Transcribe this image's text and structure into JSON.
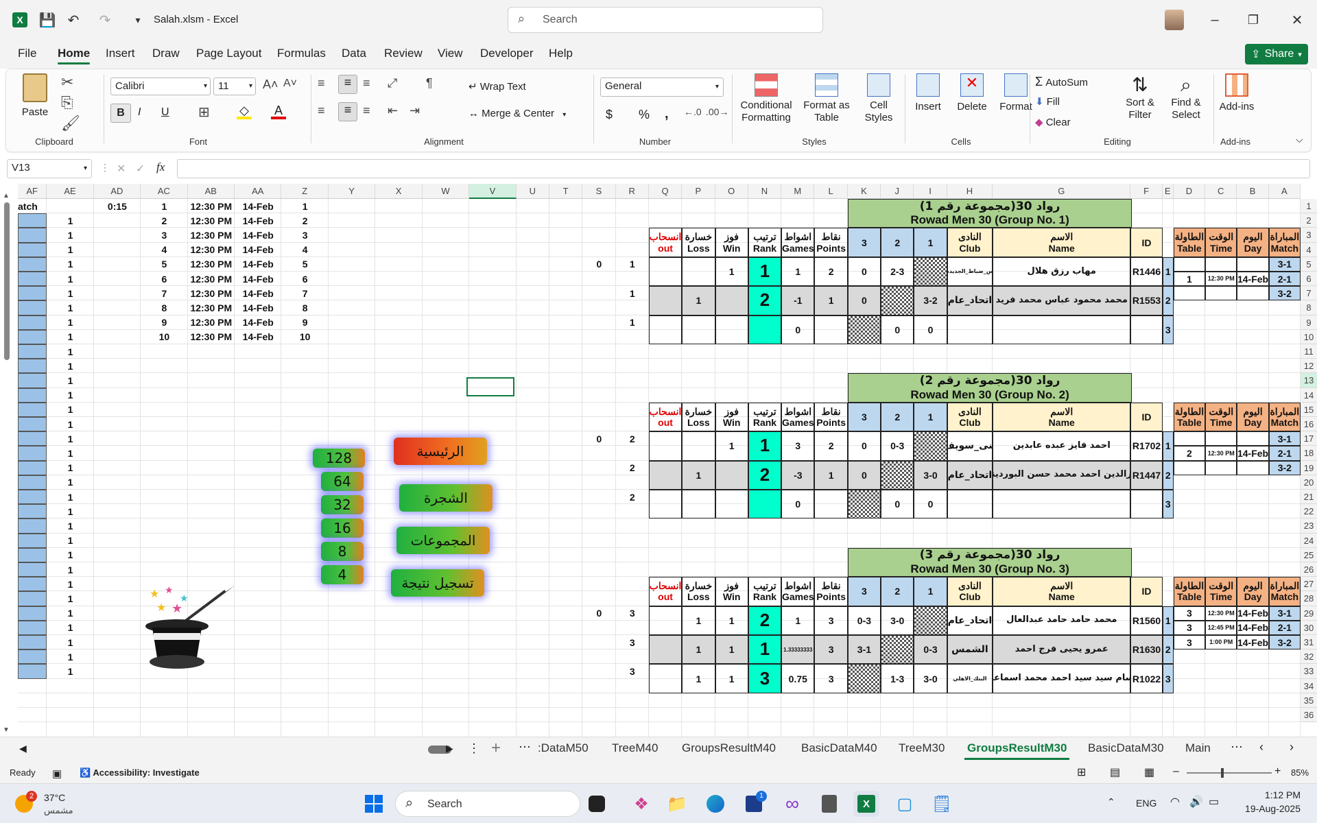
{
  "titlebar": {
    "filename": "Salah.xlsm",
    "separator": "-",
    "app": "Excel",
    "search_placeholder": "Search",
    "icons": [
      "excel-logo-icon",
      "save-icon",
      "undo-icon",
      "redo-icon",
      "customize-icon",
      "search-icon",
      "minimize-icon",
      "restore-icon",
      "close-icon"
    ]
  },
  "menu": [
    "File",
    "Home",
    "Insert",
    "Draw",
    "Page Layout",
    "Formulas",
    "Data",
    "Review",
    "View",
    "Developer",
    "Help"
  ],
  "share_label": "Share",
  "ribbon": {
    "clipboard": {
      "paste": "Paste",
      "group": "Clipboard"
    },
    "font": {
      "name": "Calibri",
      "size": "11",
      "bold": "B",
      "italic": "I",
      "underline": "U",
      "group": "Font"
    },
    "alignment": {
      "wrap": "Wrap Text",
      "merge": "Merge & Center",
      "group": "Alignment"
    },
    "number": {
      "format": "General",
      "currency": "$",
      "percent": "%",
      "comma": ",",
      "group": "Number"
    },
    "styles": {
      "conditional": "Conditional",
      "conditional2": "Formatting",
      "format_as": "Format as",
      "format_as2": "Table",
      "cell": "Cell",
      "cell2": "Styles",
      "group": "Styles"
    },
    "cells": {
      "insert": "Insert",
      "delete": "Delete",
      "format": "Format",
      "group": "Cells"
    },
    "editing": {
      "autosum": "AutoSum",
      "fill": "Fill",
      "clear": "Clear",
      "sort": "Sort &",
      "sort2": "Filter",
      "find": "Find &",
      "find2": "Select",
      "group": "Editing"
    },
    "addins": {
      "label": "Add-ins",
      "group": "Add-ins"
    }
  },
  "formula": {
    "name_box": "V13",
    "fx": "fx",
    "content": ""
  },
  "columns": [
    {
      "l": "AF",
      "w": 42
    },
    {
      "l": "AE",
      "w": 68
    },
    {
      "l": "AD",
      "w": 68
    },
    {
      "l": "AC",
      "w": 68
    },
    {
      "l": "AB",
      "w": 68
    },
    {
      "l": "AA",
      "w": 68
    },
    {
      "l": "Z",
      "w": 68
    },
    {
      "l": "Y",
      "w": 68
    },
    {
      "l": "X",
      "w": 68
    },
    {
      "l": "W",
      "w": 68
    },
    {
      "l": "V",
      "w": 68
    },
    {
      "l": "U",
      "w": 48
    },
    {
      "l": "T",
      "w": 48
    },
    {
      "l": "S",
      "w": 48
    },
    {
      "l": "R",
      "w": 48
    },
    {
      "l": "Q",
      "w": 48
    },
    {
      "l": "P",
      "w": 48
    },
    {
      "l": "O",
      "w": 48
    },
    {
      "l": "N",
      "w": 48
    },
    {
      "l": "M",
      "w": 48
    },
    {
      "l": "L",
      "w": 48
    },
    {
      "l": "K",
      "w": 48
    },
    {
      "l": "J",
      "w": 48
    },
    {
      "l": "I",
      "w": 48
    },
    {
      "l": "H",
      "w": 66
    },
    {
      "l": "G",
      "w": 200
    },
    {
      "l": "F",
      "w": 46
    },
    {
      "l": "E",
      "w": 16
    },
    {
      "l": "D",
      "w": 46
    },
    {
      "l": "C",
      "w": 46
    },
    {
      "l": "B",
      "w": 46
    },
    {
      "l": "A",
      "w": 46
    }
  ],
  "rows": [
    "1",
    "2",
    "3",
    "4",
    "5",
    "6",
    "7",
    "8",
    "9",
    "10",
    "11",
    "12",
    "13",
    "14",
    "15",
    "16",
    "17",
    "18",
    "19",
    "20",
    "21",
    "22",
    "23",
    "24",
    "25",
    "26",
    "27",
    "28",
    "29",
    "30",
    "31",
    "32",
    "33",
    "34",
    "35",
    "36"
  ],
  "left_data": {
    "header": {
      "af": "atch",
      "ad": "0:15",
      "ac": "1",
      "ab": "12:30 PM",
      "aa": "14-Feb",
      "z": "1"
    },
    "rows": [
      {
        "ae": "1",
        "ac": "2",
        "ab": "12:30 PM",
        "aa": "14-Feb",
        "z": "2"
      },
      {
        "ae": "1",
        "ac": "3",
        "ab": "12:30 PM",
        "aa": "14-Feb",
        "z": "3"
      },
      {
        "ae": "1",
        "ac": "4",
        "ab": "12:30 PM",
        "aa": "14-Feb",
        "z": "4"
      },
      {
        "ae": "1",
        "ac": "5",
        "ab": "12:30 PM",
        "aa": "14-Feb",
        "z": "5"
      },
      {
        "ae": "1",
        "ac": "6",
        "ab": "12:30 PM",
        "aa": "14-Feb",
        "z": "6"
      },
      {
        "ae": "1",
        "ac": "7",
        "ab": "12:30 PM",
        "aa": "14-Feb",
        "z": "7"
      },
      {
        "ae": "1",
        "ac": "8",
        "ab": "12:30 PM",
        "aa": "14-Feb",
        "z": "8"
      },
      {
        "ae": "1",
        "ac": "9",
        "ab": "12:30 PM",
        "aa": "14-Feb",
        "z": "9"
      },
      {
        "ae": "1",
        "ac": "10",
        "ab": "12:30 PM",
        "aa": "14-Feb",
        "z": "10"
      }
    ],
    "ae_extra": "1"
  },
  "sr_values": [
    {
      "row": 5,
      "s": "0",
      "r": "1"
    },
    {
      "row": 7,
      "s": "",
      "r": "1"
    },
    {
      "row": 9,
      "s": "",
      "r": "1"
    },
    {
      "row": 17,
      "s": "0",
      "r": "2"
    },
    {
      "row": 19,
      "s": "",
      "r": "2"
    },
    {
      "row": 21,
      "s": "",
      "r": "2"
    },
    {
      "row": 29,
      "s": "0",
      "r": "3"
    },
    {
      "row": 31,
      "s": "",
      "r": "3"
    },
    {
      "row": 33,
      "s": "",
      "r": "3"
    }
  ],
  "macro_buttons": {
    "numbers": [
      "128",
      "64",
      "32",
      "16",
      "8",
      "4"
    ],
    "main": "الرئيسية",
    "tree": "الشجرة",
    "groups": "المجموعات",
    "record": "تسجيل نتيجة"
  },
  "table_headers": {
    "out_ar": "انسحاب",
    "out": "out",
    "loss_ar": "خسارة",
    "loss": "Loss",
    "win_ar": "فوز",
    "win": "Win",
    "rank_ar": "ترتيب",
    "rank": "Rank",
    "games_ar": "اشواط",
    "games": "Games",
    "points_ar": "نقاط",
    "points": "Points",
    "c3": "3",
    "c2": "2",
    "c1": "1",
    "club_ar": "النادى",
    "club": "Club",
    "name_ar": "الاسم",
    "name": "Name",
    "id": "ID",
    "table_ar": "الطاولة",
    "table": "Table",
    "time_ar": "الوقت",
    "time": "Time",
    "day_ar": "اليوم",
    "day": "Day",
    "match_ar": "المباراة",
    "match": "Match"
  },
  "groups": [
    {
      "title_ar": "رواد 30(مجموعة رقم 1)",
      "title_en": "Rowad Men 30 (Group No.  1)",
      "players": [
        {
          "idx": "1",
          "id": "R1446",
          "name": "مهاب رزق هلال",
          "club": "س_ضباط_الجديدة",
          "club_small": true,
          "r1": "",
          "r2": "2-3",
          "r3": "0",
          "points": "2",
          "games": "1",
          "rank": "1",
          "win": "1",
          "loss": "",
          "out": ""
        },
        {
          "idx": "2",
          "id": "R1553",
          "name": "محمد محمود عباس محمد فريد",
          "club": "اتحاد_عام",
          "club_small": false,
          "r1": "3-2",
          "r2": "",
          "r3": "0",
          "points": "1",
          "games": "-1",
          "rank": "2",
          "win": "",
          "loss": "1",
          "out": ""
        },
        {
          "idx": "3",
          "id": "",
          "name": "",
          "club": "",
          "club_small": false,
          "r1": "0",
          "r2": "0",
          "r3": "",
          "points": "",
          "games": "0",
          "rank": "",
          "win": "",
          "loss": "",
          "out": ""
        }
      ],
      "schedule": [
        {
          "match": "3-1",
          "day": "",
          "time": "",
          "table": ""
        },
        {
          "match": "2-1",
          "day": "14-Feb",
          "time": "12:30 PM",
          "table": "1"
        },
        {
          "match": "3-2",
          "day": "",
          "time": "",
          "table": ""
        }
      ]
    },
    {
      "title_ar": "رواد 30(مجموعة رقم 2)",
      "title_en": "Rowad Men 30 (Group No.  2)",
      "players": [
        {
          "idx": "1",
          "id": "R1702",
          "name": "احمد فايز عبده عابدين",
          "club": "بنى_سويف",
          "club_small": false,
          "r1": "",
          "r2": "0-3",
          "r3": "0",
          "points": "2",
          "games": "3",
          "rank": "1",
          "win": "1",
          "loss": "",
          "out": ""
        },
        {
          "idx": "2",
          "id": "R1447",
          "name": "نورالدين احمد محمد حسن البوردينى",
          "club": "اتحاد_عام",
          "club_small": false,
          "r1": "3-0",
          "r2": "",
          "r3": "0",
          "points": "1",
          "games": "-3",
          "rank": "2",
          "win": "",
          "loss": "1",
          "out": ""
        },
        {
          "idx": "3",
          "id": "",
          "name": "",
          "club": "",
          "club_small": false,
          "r1": "0",
          "r2": "0",
          "r3": "",
          "points": "",
          "games": "0",
          "rank": "",
          "win": "",
          "loss": "",
          "out": ""
        }
      ],
      "schedule": [
        {
          "match": "3-1",
          "day": "",
          "time": "",
          "table": ""
        },
        {
          "match": "2-1",
          "day": "14-Feb",
          "time": "12:30 PM",
          "table": "2"
        },
        {
          "match": "3-2",
          "day": "",
          "time": "",
          "table": ""
        }
      ]
    },
    {
      "title_ar": "رواد 30(مجموعة رقم 3)",
      "title_en": "Rowad Men 30 (Group No.  3)",
      "players": [
        {
          "idx": "1",
          "id": "R1560",
          "name": "محمد حامد حامد عبدالعال",
          "club": "اتحاد_عام",
          "club_small": false,
          "r1": "",
          "r2": "3-0",
          "r3": "0-3",
          "points": "3",
          "games": "1",
          "rank": "2",
          "win": "1",
          "loss": "1",
          "out": ""
        },
        {
          "idx": "2",
          "id": "R1630",
          "name": "عمرو يحيى فرج احمد",
          "club": "الشمس",
          "club_small": false,
          "r1": "0-3",
          "r2": "",
          "r3": "3-1",
          "points": "3",
          "games": "1.33333333",
          "rank": "1",
          "win": "1",
          "loss": "1",
          "out": ""
        },
        {
          "idx": "3",
          "id": "R1022",
          "name": "حسام سيد سيد احمد محمد اسماعيل",
          "club": "البنك_الاهلي",
          "club_small": true,
          "r1": "3-0",
          "r2": "1-3",
          "r3": "",
          "points": "3",
          "games": "0.75",
          "rank": "3",
          "win": "1",
          "loss": "1",
          "out": ""
        }
      ],
      "schedule": [
        {
          "match": "3-1",
          "day": "14-Feb",
          "time": "12:30 PM",
          "table": "3"
        },
        {
          "match": "2-1",
          "day": "14-Feb",
          "time": "12:45 PM",
          "table": "3"
        },
        {
          "match": "3-2",
          "day": "14-Feb",
          "time": "1:00 PM",
          "table": "3"
        }
      ]
    }
  ],
  "sheet_tabs": [
    ":DataM50",
    "TreeM40",
    "GroupsResultM40",
    "BasicDataM40",
    "TreeM30",
    "GroupsResultM30",
    "BasicDataM30",
    "Main"
  ],
  "active_tab": "GroupsResultM30",
  "status": {
    "ready": "Ready",
    "accessibility": "Accessibility: Investigate",
    "zoom": "85%"
  },
  "taskbar": {
    "weather_temp": "37°C",
    "weather_desc": "مشمس",
    "weather_badge": "2",
    "search": "Search",
    "lang": "ENG",
    "time": "1:12 PM",
    "date": "19-Aug-2025",
    "badge": "1"
  }
}
